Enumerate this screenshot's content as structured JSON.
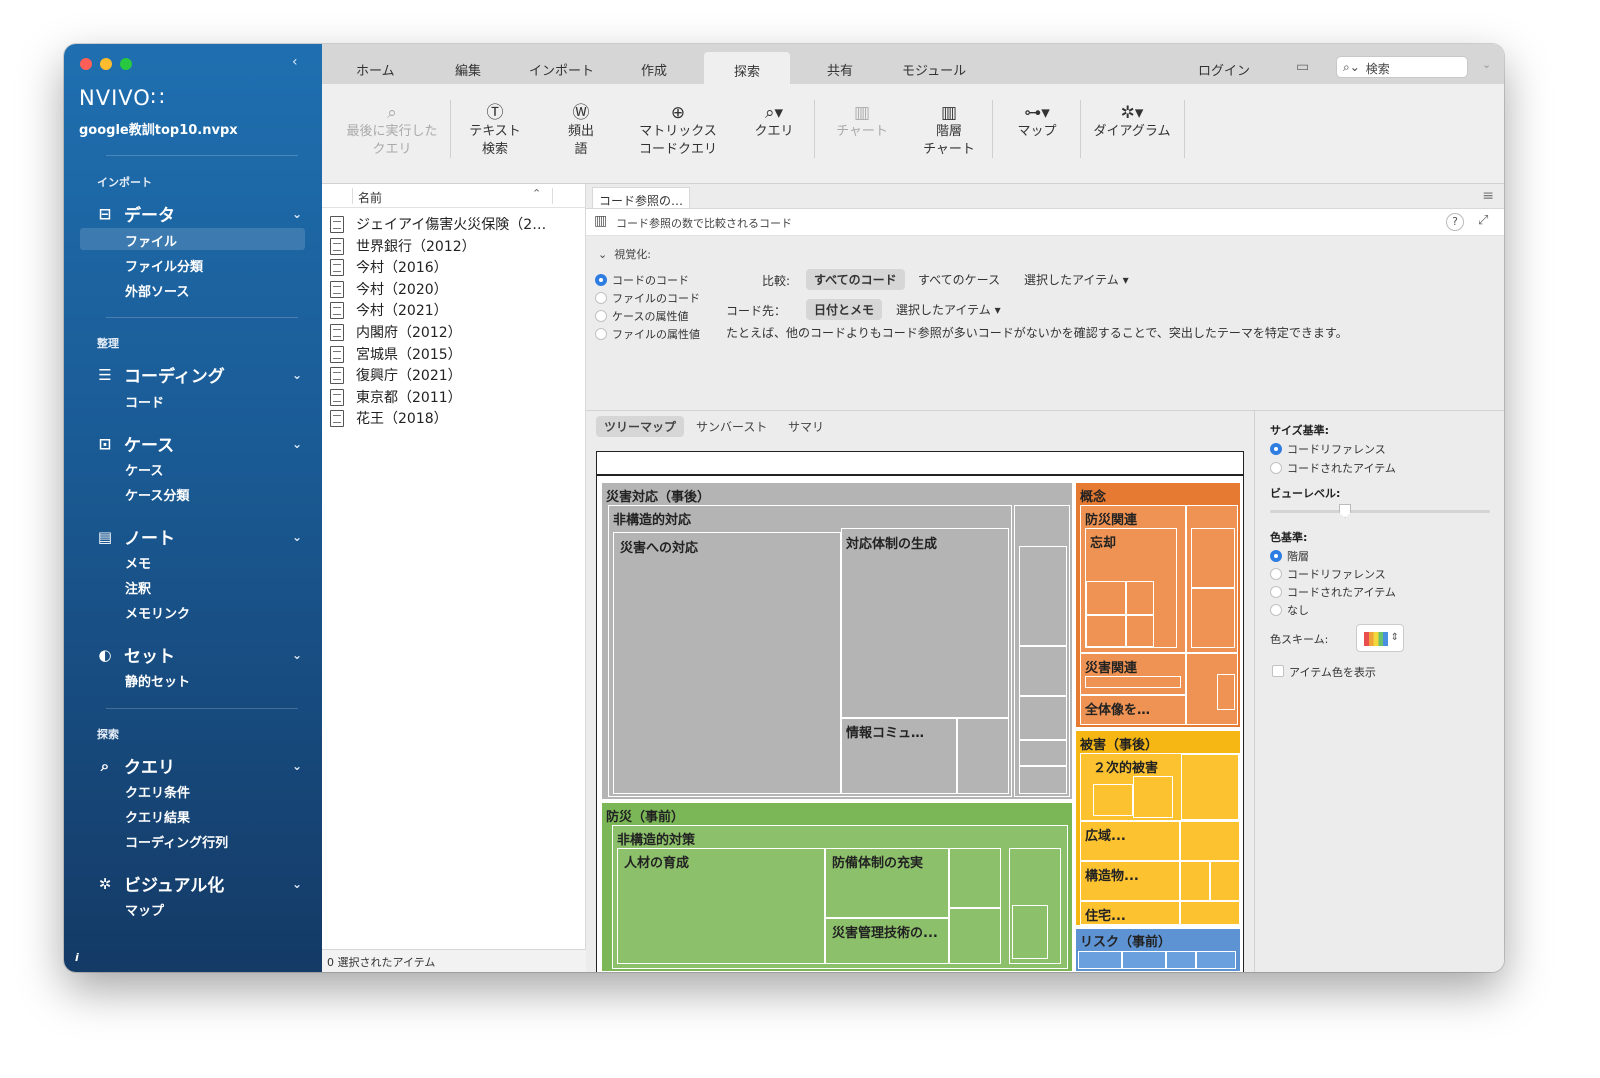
{
  "app": {
    "logo": "NVIVO∷",
    "project": "google教訓top10.nvpx"
  },
  "sidebar": {
    "sections": [
      {
        "label": "インポート"
      },
      {
        "label": "整理"
      },
      {
        "label": "探索"
      }
    ],
    "groups": [
      {
        "label": "データ",
        "items": [
          "ファイル",
          "ファイル分類",
          "外部ソース"
        ]
      },
      {
        "label": "コーディング",
        "items": [
          "コード"
        ]
      },
      {
        "label": "ケース",
        "items": [
          "ケース",
          "ケース分類"
        ]
      },
      {
        "label": "ノート",
        "items": [
          "メモ",
          "注釈",
          "メモリンク"
        ]
      },
      {
        "label": "セット",
        "items": [
          "静的セット"
        ]
      },
      {
        "label": "クエリ",
        "items": [
          "クエリ条件",
          "クエリ結果",
          "コーディング行列"
        ]
      },
      {
        "label": "ビジュアル化",
        "items": [
          "マップ"
        ]
      }
    ],
    "active_item": "ファイル",
    "info": "i"
  },
  "tabs": [
    "ホーム",
    "編集",
    "インポート",
    "作成",
    "探索",
    "共有",
    "モジュール"
  ],
  "active_tab": "探索",
  "toolbar": {
    "login": "ログイン",
    "search_placeholder": "検索"
  },
  "ribbon": [
    {
      "line1": "最後に実行した",
      "line2": "クエリ",
      "icon": "magnifier-icon",
      "enabled": false
    },
    {
      "line1": "テキスト",
      "line2": "検索",
      "icon": "text-search-icon",
      "enabled": true
    },
    {
      "line1": "頻出",
      "line2": "語",
      "icon": "word-frequency-icon",
      "enabled": true
    },
    {
      "line1": "マトリックス",
      "line2": "コードクエリ",
      "icon": "matrix-icon",
      "enabled": true
    },
    {
      "line1": "クエリ",
      "line2": "",
      "icon": "query-icon",
      "enabled": true
    },
    {
      "line1": "チャート",
      "line2": "",
      "icon": "chart-icon",
      "enabled": false
    },
    {
      "line1": "階層",
      "line2": "チャート",
      "icon": "hierarchy-chart-icon",
      "enabled": true
    },
    {
      "line1": "マップ",
      "line2": "",
      "icon": "map-icon",
      "enabled": true
    },
    {
      "line1": "ダイアグラム",
      "line2": "",
      "icon": "diagram-icon",
      "enabled": true
    }
  ],
  "filelist": {
    "header": "名前",
    "files": [
      "ジェイアイ傷害火災保険（2…",
      "世界銀行（2012）",
      "今村（2016）",
      "今村（2020）",
      "今村（2021）",
      "内閣府（2012）",
      "宮城県（2015）",
      "復興庁（2021）",
      "東京都（2011）",
      "花王（2018）"
    ],
    "status": "0 選択されたアイテム"
  },
  "detail": {
    "tab": "コード参照の…",
    "subtitle": "コード参照の数で比較されるコード",
    "visualize_label": "視覚化:",
    "radio_options": [
      "コードのコード",
      "ファイルのコード",
      "ケースの属性値",
      "ファイルの属性値"
    ],
    "compare_label": "比較:",
    "compare_options": [
      "すべてのコード",
      "すべてのケース",
      "選択したアイテム ▾"
    ],
    "code_to_label": "コード先：",
    "code_to_options": [
      "日付とメモ",
      "選択したアイテム ▾"
    ],
    "description": "たとえば、他のコードよりもコード参照が多いコードがないかを確認することで、突出したテーマを特定できます。",
    "view_tabs": [
      "ツリーマップ",
      "サンバースト",
      "サマリ"
    ]
  },
  "treemap": {
    "labels": {
      "disaster_response": "災害対応（事後）",
      "nonstructural_response": "非構造的対応",
      "response_to_disaster": "災害への対応",
      "response_system": "対応体制の生成",
      "info_comm": "情報コミュ…",
      "concept": "概念",
      "prevention_related": "防災関連",
      "forgetting": "忘却",
      "disaster_related": "災害関連",
      "overall": "全体像を…",
      "damage": "被害（事後）",
      "secondary_damage": "２次的被害",
      "wide_area": "広域...",
      "structures": "構造物...",
      "housing": "住宅...",
      "prevention_pre": "防災（事前）",
      "nonstructural_measures": "非構造的対策",
      "human_resources": "人材の育成",
      "defense_system": "防備体制の充実",
      "disaster_mgmt": "災害管理技術の...",
      "risk": "リスク（事前）"
    },
    "colors": {
      "gray": "#b4b4b4",
      "orange": "#ee9354",
      "yellow": "#fcc230",
      "green": "#8cc06a",
      "blue": "#5e93d3"
    }
  },
  "options": {
    "size_basis_label": "サイズ基準:",
    "size_options": [
      "コードリファレンス",
      "コードされたアイテム"
    ],
    "view_level_label": "ビューレベル:",
    "color_basis_label": "色基準:",
    "color_options": [
      "階層",
      "コードリファレンス",
      "コードされたアイテム",
      "なし"
    ],
    "color_scheme_label": "色スキーム:",
    "show_item_color": "アイテム色を表示"
  }
}
